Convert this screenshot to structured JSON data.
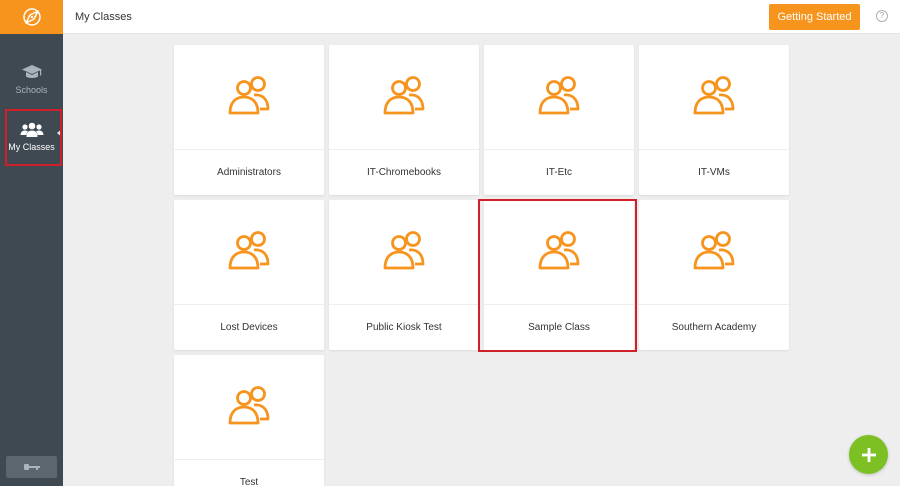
{
  "sidebar": {
    "logo_icon": "compass-icon",
    "items": [
      {
        "label": "Schools",
        "icon": "graduation-cap-icon"
      },
      {
        "label": "My Classes",
        "icon": "users-icon"
      }
    ],
    "bottom_icon": "key-icon"
  },
  "header": {
    "title": "My Classes",
    "getting_started_label": "Getting Started",
    "help_icon": "?"
  },
  "classes": [
    {
      "name": "Administrators"
    },
    {
      "name": "IT-Chromebooks"
    },
    {
      "name": "IT-Etc"
    },
    {
      "name": "IT-VMs"
    },
    {
      "name": "Lost Devices"
    },
    {
      "name": "Public Kiosk Test"
    },
    {
      "name": "Sample Class"
    },
    {
      "name": "Southern Academy"
    },
    {
      "name": "Test"
    }
  ],
  "colors": {
    "accent": "#f7941d",
    "sidebar": "#3f4951",
    "fab": "#7cc024",
    "highlight": "#d0202a"
  },
  "fab_icon": "plus-icon"
}
